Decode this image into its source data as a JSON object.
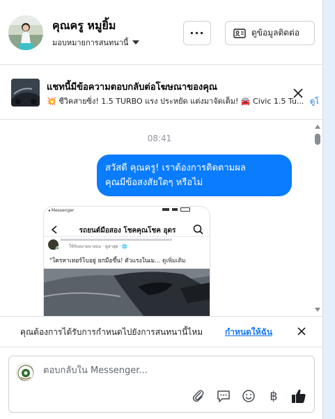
{
  "header": {
    "name": "คุณครู หมูยิ้ม",
    "assignment_label": "มอบหมายการสนทนานี้",
    "more_label": "···",
    "contact_info_label": "ดูข้อมูลติดต่อ"
  },
  "ad_banner": {
    "title": "แชทนี้มีข้อความตอบกลับต่อโฆษณาของคุณ",
    "subtitle": "💥 ชีวิคสายซิ่ง! 1.5 TURBO แรง ประหยัด แต่งมาจัดเต็ม! 🚘 Civic 1.5 Tu...",
    "more_link": "ดูโ"
  },
  "chat": {
    "timestamp": "08:41",
    "messages": [
      {
        "sender": "page",
        "text_line1": "สวัสดี คุณครู! เราต้องการติดตามผล",
        "text_line2": "คุณมีข้อสงสัยใดๆ หรือไม่"
      }
    ],
    "shared_post": {
      "status_app": "◂ Messenger",
      "page_title": "รถยนต์มือสอง โชคคุณโชค อุดร",
      "author_line": "ใช้รับหงายบาลบบ · ดูล่าสุด · 🌐",
      "caption": "\"ใครหาเทอร์โบอยู่ ยกมือขึ้น! ตัวแรงในเม...",
      "caption_more": "ดูเพิ่มเติม"
    }
  },
  "reminder": {
    "text": "คุณต้องการได้รับการกำหนดไปยังการสนทนานี้ไหม",
    "link": "กำหนดให้ฉัน"
  },
  "composer": {
    "placeholder": "ตอบกลับใน Messenger...",
    "baht_symbol": "฿"
  },
  "colors": {
    "accent": "#0a7cff",
    "link": "#1877f2",
    "border": "#dddfe2"
  },
  "icons": [
    "chevron-down-icon",
    "contact-card-icon",
    "close-icon",
    "paperclip-icon",
    "quick-reply-icon",
    "emoji-icon",
    "baht-icon",
    "thumbs-up-icon",
    "search-icon",
    "back-arrow-icon"
  ]
}
